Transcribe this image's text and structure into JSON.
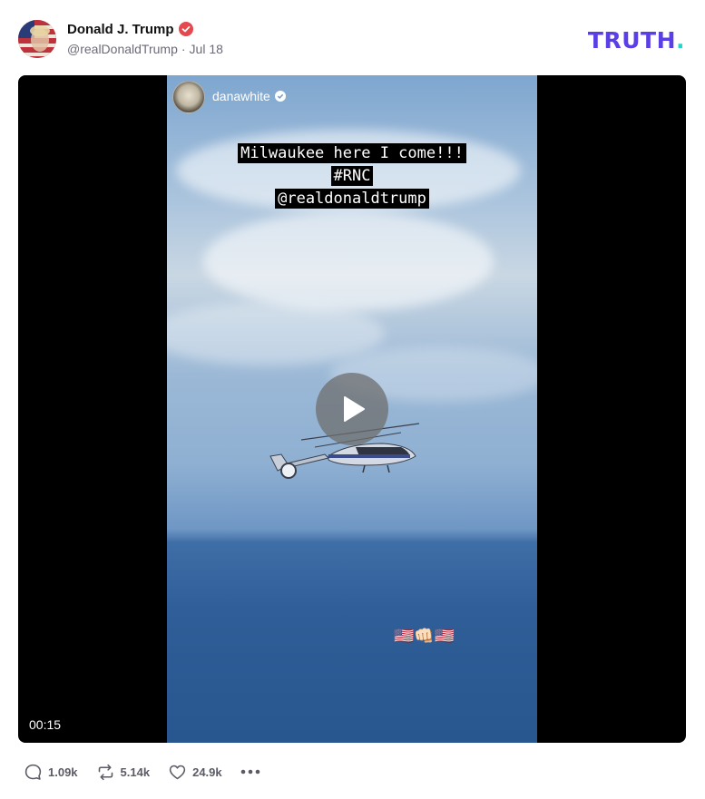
{
  "post": {
    "author_name": "Donald J. Trump",
    "handle": "@realDonaldTrump",
    "date": "Jul 18",
    "separator": "·",
    "verified": true
  },
  "brand": {
    "logo_text": "TRUTH",
    "logo_dot": ".",
    "color": "#5a3ee6",
    "dot_color": "#23d6c7"
  },
  "video": {
    "story_username": "danawhite",
    "caption_lines": [
      "Milwaukee here I come!!!",
      "#RNC",
      "@realdonaldtrump"
    ],
    "emojis": "🇺🇸👊🏻🇺🇸",
    "duration": "00:15",
    "play_icon": "play-icon"
  },
  "actions": {
    "replies": "1.09k",
    "retruths": "5.14k",
    "likes": "24.9k"
  },
  "colors": {
    "verified_badge": "#e5484d",
    "icon_gray": "#5b5b66"
  }
}
